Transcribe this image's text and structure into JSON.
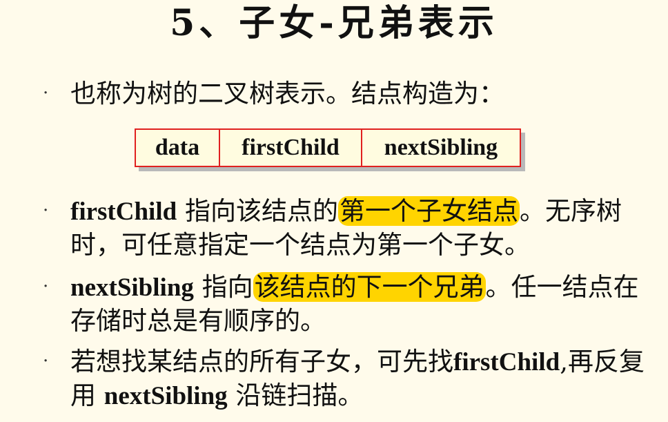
{
  "title": "5、子女-兄弟表示",
  "bullet_glyph": "·",
  "bullet1": {
    "text": "也称为树的二叉树表示。结点构造为："
  },
  "node_fields": [
    "data",
    "firstChild",
    "nextSibling"
  ],
  "bullet2": {
    "term": "firstChild",
    "pre": " 指向该结点的",
    "highlight": "第一个子女结点",
    "post": "。无序树时，可任意指定一个结点为第一个子女。"
  },
  "bullet3": {
    "term": "nextSibling",
    "pre": " 指向",
    "highlight": "该结点的下一个兄弟",
    "post": "。任一结点在存储时总是有顺序的。"
  },
  "bullet4": {
    "pre": "若想找某结点的所有子女，可先找",
    "term1": "firstChild",
    "mid": ",再反复用 ",
    "term2": "nextSibling",
    "post": " 沿链扫描。"
  },
  "colors": {
    "background": "#fffbeb",
    "highlight": "#ffd400",
    "box_border": "#e0201f",
    "box_fill": "#fffce0"
  }
}
